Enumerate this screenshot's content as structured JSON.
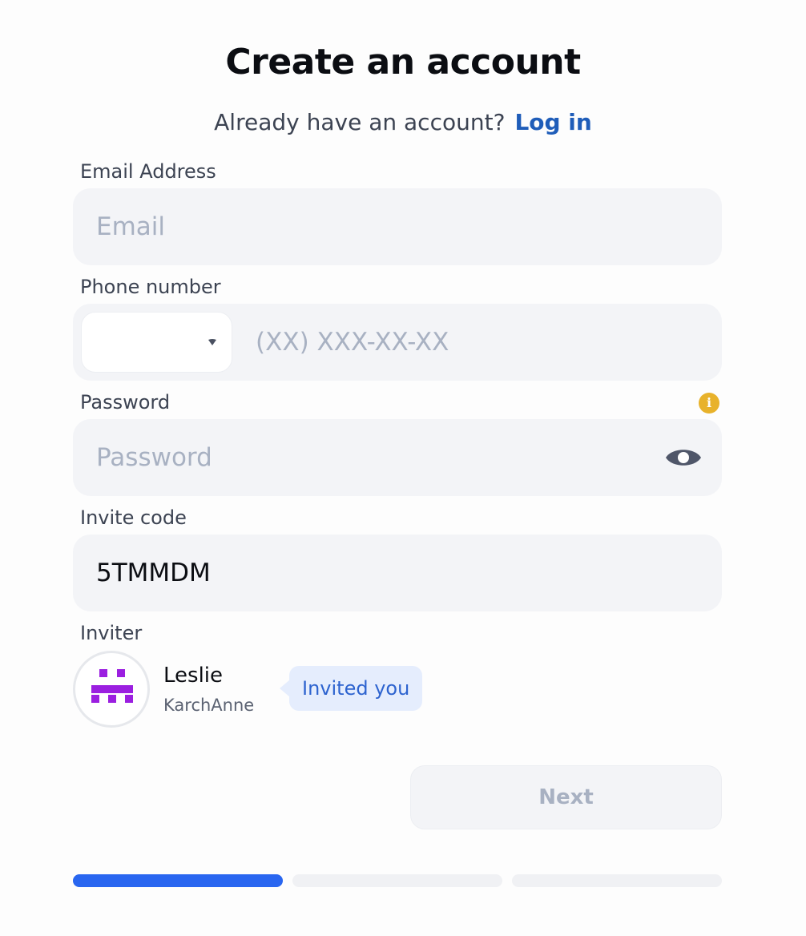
{
  "header": {
    "title": "Create an account",
    "subtitle": "Already have an account?",
    "login_link": "Log in"
  },
  "form": {
    "email": {
      "label": "Email Address",
      "placeholder": "Email",
      "value": ""
    },
    "phone": {
      "label": "Phone number",
      "placeholder": "(XX) XXX-XX-XX",
      "value": "",
      "country_code": ""
    },
    "password": {
      "label": "Password",
      "placeholder": "Password",
      "value": "",
      "info_icon": "info-icon",
      "toggle_icon": "eye-icon"
    },
    "invite_code": {
      "label": "Invite code",
      "value": "5TMMDM"
    }
  },
  "inviter": {
    "label": "Inviter",
    "name": "Leslie",
    "username": "KarchAnne",
    "badge": "Invited you",
    "avatar_color": "#9b1fe0"
  },
  "actions": {
    "next_label": "Next"
  },
  "progress": {
    "steps": [
      {
        "step": 1,
        "fill": 1.0
      },
      {
        "step": 2,
        "fill": 0.0
      },
      {
        "step": 3,
        "fill": 0.0
      }
    ],
    "active_color": "#2966f0"
  }
}
